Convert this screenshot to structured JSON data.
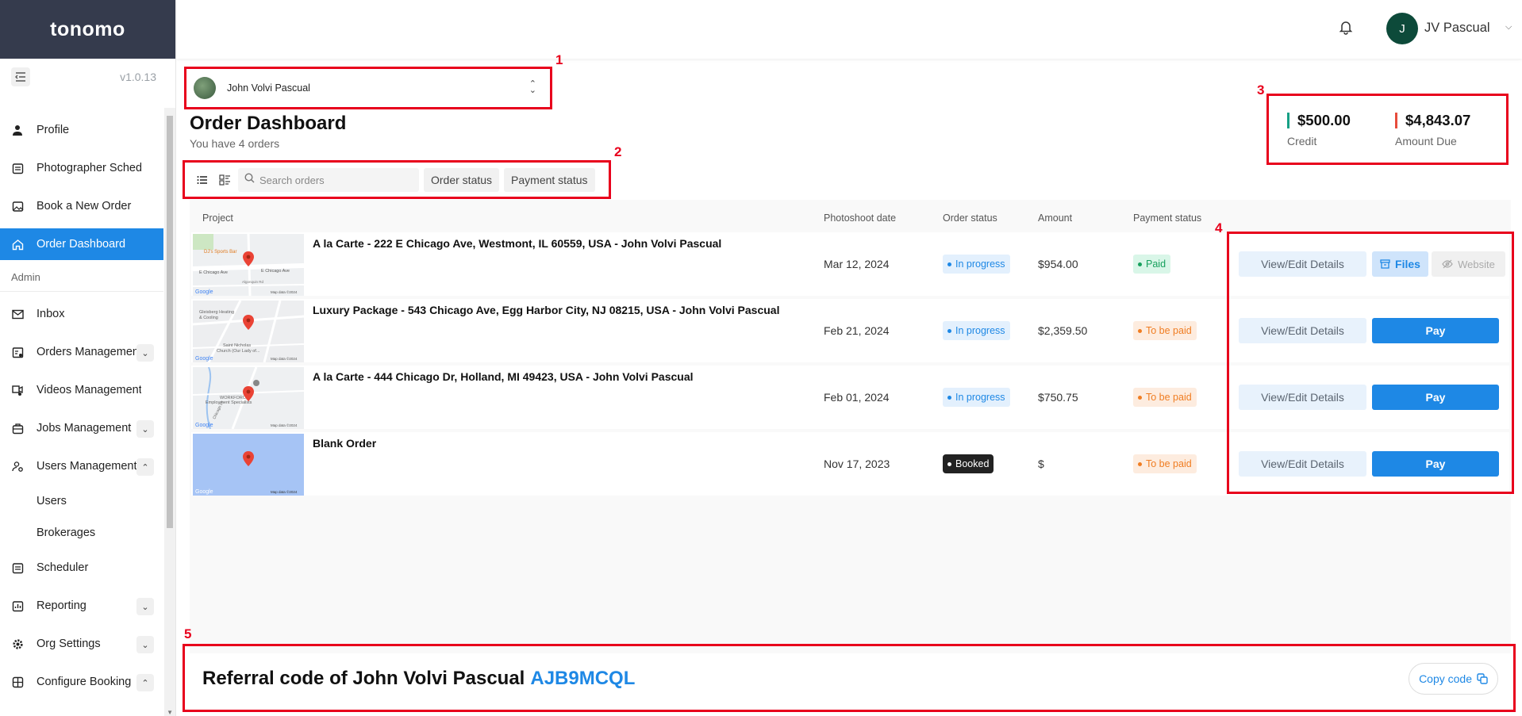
{
  "app": {
    "logo": "tonomo",
    "version": "v1.0.13"
  },
  "sidebar": {
    "items": [
      {
        "label": "Profile",
        "icon": "person-icon"
      },
      {
        "label": "Photographer Schedule",
        "icon": "calendar-icon"
      },
      {
        "label": "Book a New Order",
        "icon": "image-icon"
      },
      {
        "label": "Order Dashboard",
        "icon": "home-icon",
        "active": true
      }
    ],
    "admin_label": "Admin",
    "admin_items": [
      {
        "label": "Inbox",
        "icon": "envelope-icon"
      },
      {
        "label": "Orders Management",
        "icon": "orders-icon",
        "chevron": "down"
      },
      {
        "label": "Videos Management",
        "icon": "video-icon"
      },
      {
        "label": "Jobs Management",
        "icon": "briefcase-icon",
        "chevron": "down"
      },
      {
        "label": "Users Management",
        "icon": "users-icon",
        "chevron": "up"
      }
    ],
    "sub_items": [
      "Users",
      "Brokerages"
    ],
    "bottom_items": [
      {
        "label": "Scheduler",
        "icon": "scheduler-icon"
      },
      {
        "label": "Reporting",
        "icon": "chart-icon",
        "chevron": "down"
      },
      {
        "label": "Org Settings",
        "icon": "gear-icon",
        "chevron": "down"
      },
      {
        "label": "Configure Booking",
        "icon": "grid-icon",
        "chevron": "up"
      }
    ]
  },
  "header": {
    "avatar_initial": "J",
    "user_name": "JV Pascual"
  },
  "member_select": {
    "name": "John Volvi Pascual"
  },
  "page": {
    "title": "Order Dashboard",
    "subtitle": "You have 4 orders"
  },
  "toolbar": {
    "search_placeholder": "Search orders",
    "order_status": "Order status",
    "payment_status": "Payment status"
  },
  "totals": {
    "credit_value": "$500.00",
    "credit_label": "Credit",
    "due_value": "$4,843.07",
    "due_label": "Amount Due"
  },
  "annotations": [
    "1",
    "2",
    "3",
    "4",
    "5"
  ],
  "table": {
    "headers": {
      "project": "Project",
      "date": "Photoshoot date",
      "order_status": "Order status",
      "amount": "Amount",
      "payment_status": "Payment status"
    },
    "rows": [
      {
        "project": "A la Carte - 222 E Chicago Ave, Westmont, IL 60559, USA - John Volvi Pascual",
        "date": "Mar 12, 2024",
        "order_status": "In progress",
        "amount": "$954.00",
        "payment_status": "Paid",
        "details": "View/Edit Details",
        "files": "Files",
        "website": "Website"
      },
      {
        "project": "Luxury Package - 543 Chicago Ave, Egg Harbor City, NJ 08215, USA - John Volvi Pascual",
        "date": "Feb 21, 2024",
        "order_status": "In progress",
        "amount": "$2,359.50",
        "payment_status": "To be paid",
        "details": "View/Edit Details",
        "pay": "Pay"
      },
      {
        "project": "A la Carte - 444 Chicago Dr, Holland, MI 49423, USA - John Volvi Pascual",
        "date": "Feb 01, 2024",
        "order_status": "In progress",
        "amount": "$750.75",
        "payment_status": "To be paid",
        "details": "View/Edit Details",
        "pay": "Pay"
      },
      {
        "project": "Blank Order",
        "date": "Nov 17, 2023",
        "order_status": "Booked",
        "amount": "$",
        "payment_status": "To be paid",
        "details": "View/Edit Details",
        "pay": "Pay"
      }
    ],
    "map_labels": {
      "row0": [
        "DJ's Sports Bar",
        "E Chicago Ave",
        "E Chicago Ave",
        "Algonquin Rd",
        "Google",
        "Map data ©2024"
      ],
      "row1": [
        "Gleisberg Heating",
        "& Cooling",
        "Saint Nicholas",
        "Church (Our Lady of...",
        "Google",
        "Map data ©2024"
      ],
      "row2": [
        "WORKFORCE",
        "Employment Specialists",
        "Chicago Dr",
        "Google",
        "Map data ©2024"
      ],
      "row3": [
        "Google",
        "Map data ©2024"
      ]
    }
  },
  "referral": {
    "label": "Referral code of John Volvi Pascual",
    "code": "AJB9MCQL",
    "copy": "Copy code"
  },
  "colors": {
    "accent": "#1e88e5",
    "sidebar_dark": "#353b4d",
    "annotation": "#e8001c",
    "credit": "#16a085",
    "due": "#e74c3c"
  }
}
